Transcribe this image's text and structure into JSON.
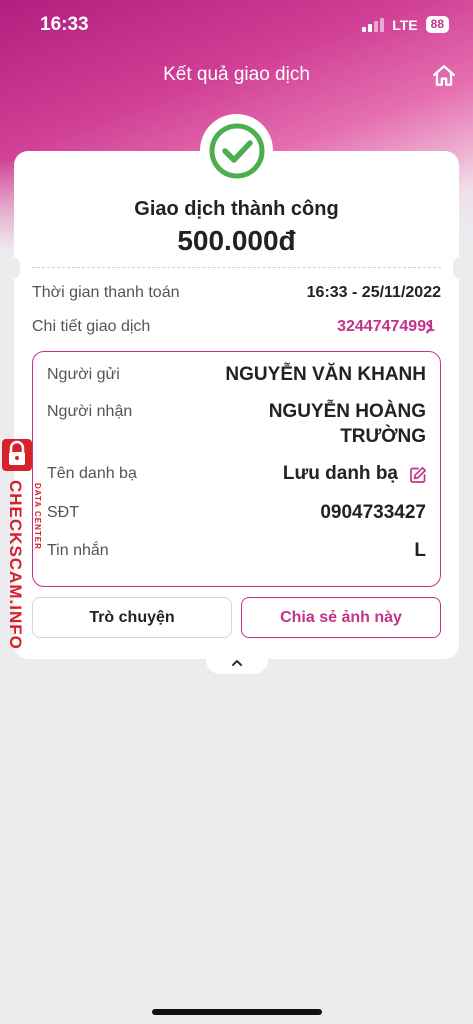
{
  "status_bar": {
    "time": "16:33",
    "network": "LTE",
    "battery": "88"
  },
  "header": {
    "title": "Kết quả giao dịch",
    "home_icon": "home-icon"
  },
  "result": {
    "icon": "check-circle-icon",
    "title": "Giao dịch thành công",
    "amount": "500.000đ"
  },
  "info": {
    "payment_time_label": "Thời gian thanh toán",
    "payment_time_value": "16:33 - 25/11/2022",
    "details_label": "Chi tiết giao dịch",
    "details_value": "32447474991"
  },
  "details": {
    "sender_label": "Người gửi",
    "sender_value": "NGUYỄN VĂN KHANH",
    "receiver_label": "Người nhận",
    "receiver_value_line1": "NGUYỄN HOÀNG",
    "receiver_value_line2": "TRƯỜNG",
    "contact_label": "Tên danh bạ",
    "contact_value": "Lưu danh bạ",
    "phone_label": "SĐT",
    "phone_value": "0904733427",
    "message_label": "Tin nhắn",
    "message_value": "L"
  },
  "buttons": {
    "chat": "Trò chuyện",
    "share": "Chia sẻ ảnh này"
  },
  "watermark": {
    "text": "CHECKSCAM.INFO",
    "sub": "DATA CENTER"
  },
  "colors": {
    "accent": "#c2338a",
    "success": "#4cae4c",
    "watermark": "#d6202a"
  }
}
